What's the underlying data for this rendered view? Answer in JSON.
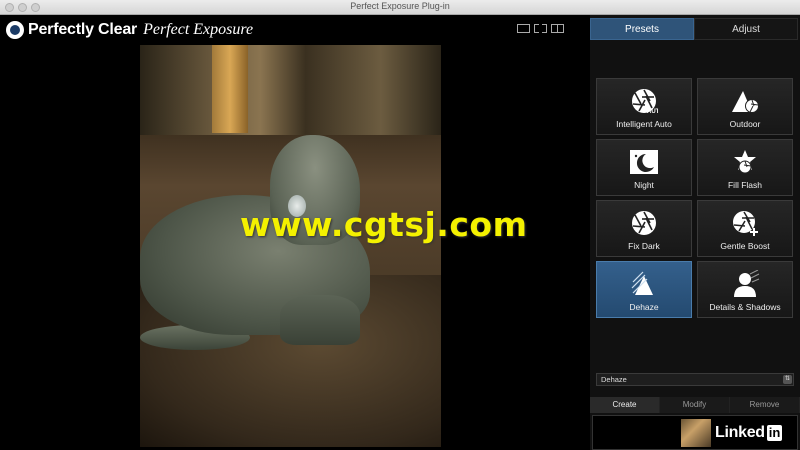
{
  "window": {
    "title": "Perfect Exposure Plug-in"
  },
  "brand": {
    "name": "Perfectly Clear",
    "product": "Perfect Exposure"
  },
  "tabs": [
    {
      "label": "Presets",
      "active": true
    },
    {
      "label": "Adjust",
      "active": false
    }
  ],
  "presets": [
    {
      "label": "Intelligent Auto",
      "icon": "aperture-auto-icon",
      "active": false
    },
    {
      "label": "Outdoor",
      "icon": "mountain-aperture-icon",
      "active": false
    },
    {
      "label": "Night",
      "icon": "moon-icon",
      "active": false
    },
    {
      "label": "Fill Flash",
      "icon": "flash-icon",
      "active": false
    },
    {
      "label": "Fix Dark",
      "icon": "aperture-icon",
      "active": false
    },
    {
      "label": "Gentle Boost",
      "icon": "aperture-plus-icon",
      "active": false
    },
    {
      "label": "Dehaze",
      "icon": "dehaze-icon",
      "active": true
    },
    {
      "label": "Details & Shadows",
      "icon": "portrait-detail-icon",
      "active": false
    }
  ],
  "preset_select": {
    "value": "Dehaze"
  },
  "sub_tabs": [
    {
      "label": "Create",
      "active": true
    },
    {
      "label": "Modify",
      "active": false
    },
    {
      "label": "Remove",
      "active": false
    }
  ],
  "watermark": "www.cgtsj.com",
  "branding_overlay": "Linked",
  "branding_overlay_box": "in",
  "accent_color": "#2f5479"
}
